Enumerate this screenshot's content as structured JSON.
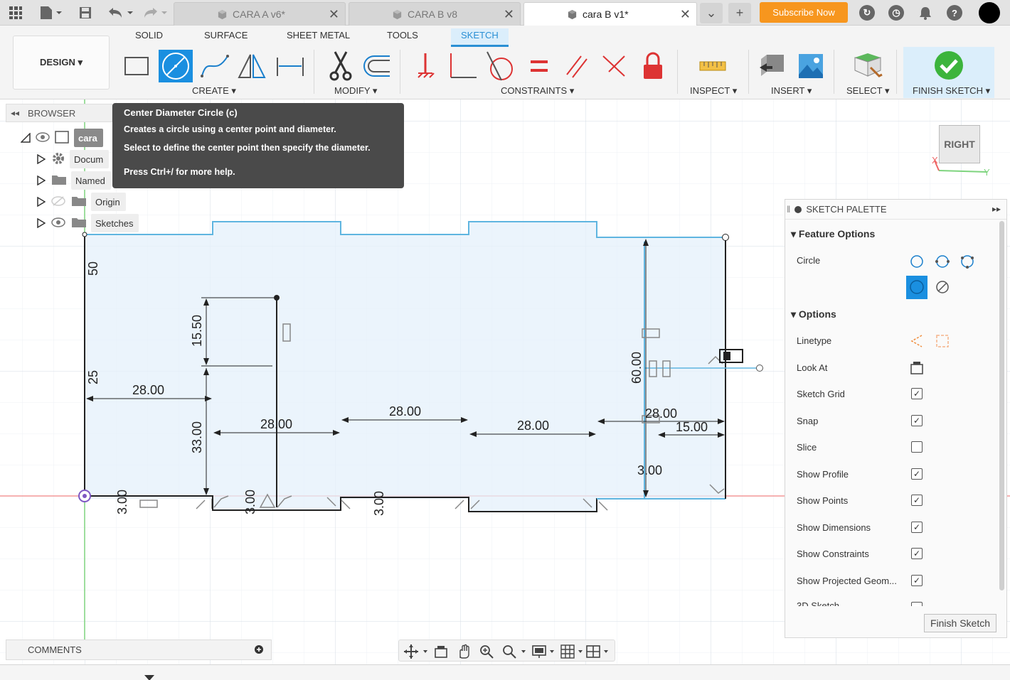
{
  "tabs": [
    {
      "label": "CARA A v6*",
      "active": false
    },
    {
      "label": "CARA B v8",
      "active": false
    },
    {
      "label": "cara B v1*",
      "active": true
    }
  ],
  "header": {
    "subscribe_label": "Subscribe Now"
  },
  "ribbon": {
    "design_label": "DESIGN ▾",
    "workspace_tabs": [
      "SOLID",
      "SURFACE",
      "SHEET METAL",
      "TOOLS",
      "SKETCH"
    ],
    "groups": {
      "create": "CREATE ▾",
      "modify": "MODIFY ▾",
      "constraints": "CONSTRAINTS ▾",
      "inspect": "INSPECT ▾",
      "insert": "INSERT ▾",
      "select": "SELECT ▾",
      "finish": "FINISH SKETCH ▾"
    }
  },
  "browser": {
    "title": "BROWSER",
    "items": [
      "cara",
      "Docum",
      "Named",
      "Origin",
      "Sketches"
    ]
  },
  "tooltip": {
    "title": "Center Diameter Circle (c)",
    "line1": "Creates a circle using a center point and diameter.",
    "line2": "Select to define the center point then specify the diameter.",
    "line3": "Press Ctrl+/ for more help."
  },
  "viewcube": {
    "label": "RIGHT",
    "x_axis": "X",
    "y_axis": "Y"
  },
  "palette": {
    "title": "SKETCH PALETTE",
    "feature_options": "Feature Options",
    "circle_label": "Circle",
    "options_label": "Options",
    "linetype": "Linetype",
    "look_at": "Look At",
    "settings": [
      {
        "label": "Sketch Grid",
        "checked": true
      },
      {
        "label": "Snap",
        "checked": true
      },
      {
        "label": "Slice",
        "checked": false
      },
      {
        "label": "Show Profile",
        "checked": true
      },
      {
        "label": "Show Points",
        "checked": true
      },
      {
        "label": "Show Dimensions",
        "checked": true
      },
      {
        "label": "Show Constraints",
        "checked": true
      },
      {
        "label": "Show Projected Geom...",
        "checked": true
      }
    ],
    "partial_row": "3D Sketch",
    "finish_button": "Finish Sketch"
  },
  "dimensions": {
    "d50": "50",
    "d25": "25",
    "d15_50": "15.50",
    "d33_00": "33.00",
    "d28_left": "28.00",
    "d28_mid": "28.00",
    "d28_top": "28.00",
    "d28_right": "28.00",
    "d28_far": "28.00",
    "d60_00": "60.00",
    "d15_00": "15.00",
    "d3_00_right": "3.00",
    "d3_00_a": "3.00",
    "d3_00_b": "3.00",
    "d3_00_c": "3.00"
  },
  "comments": {
    "label": "COMMENTS"
  }
}
